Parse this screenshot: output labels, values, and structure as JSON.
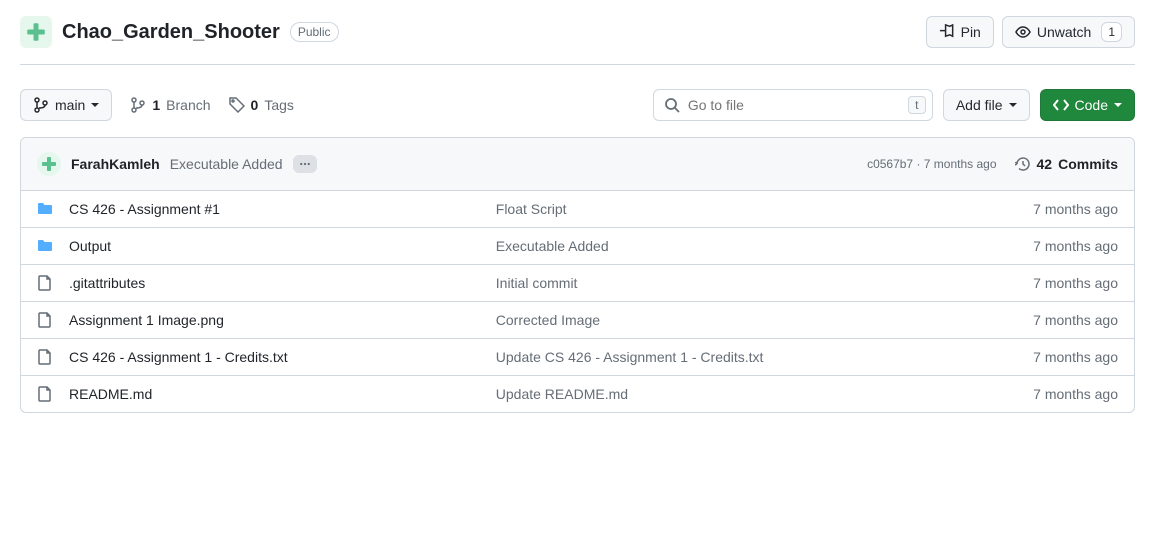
{
  "repo": {
    "name": "Chao_Garden_Shooter",
    "visibility": "Public"
  },
  "actions": {
    "pin": "Pin",
    "unwatch": "Unwatch",
    "unwatch_count": "1"
  },
  "branch": {
    "current": "main",
    "branches_count": "1",
    "branches_label": "Branch",
    "tags_count": "0",
    "tags_label": "Tags"
  },
  "toolbar": {
    "search_placeholder": "Go to file",
    "search_key": "t",
    "add_file": "Add file",
    "code": "Code"
  },
  "latest_commit": {
    "author": "FarahKamleh",
    "message": "Executable Added",
    "hash": "c0567b7",
    "sep": "·",
    "time": "7 months ago",
    "commits_count": "42",
    "commits_label": "Commits"
  },
  "files": [
    {
      "type": "folder",
      "name": "CS 426 - Assignment #1",
      "commit": "Float Script",
      "time": "7 months ago"
    },
    {
      "type": "folder",
      "name": "Output",
      "commit": "Executable Added",
      "time": "7 months ago"
    },
    {
      "type": "file",
      "name": ".gitattributes",
      "commit": "Initial commit",
      "time": "7 months ago"
    },
    {
      "type": "file",
      "name": "Assignment 1 Image.png",
      "commit": "Corrected Image",
      "time": "7 months ago"
    },
    {
      "type": "file",
      "name": "CS 426 - Assignment 1 - Credits.txt",
      "commit": "Update CS 426 - Assignment 1 - Credits.txt",
      "time": "7 months ago"
    },
    {
      "type": "file",
      "name": "README.md",
      "commit": "Update README.md",
      "time": "7 months ago"
    }
  ]
}
